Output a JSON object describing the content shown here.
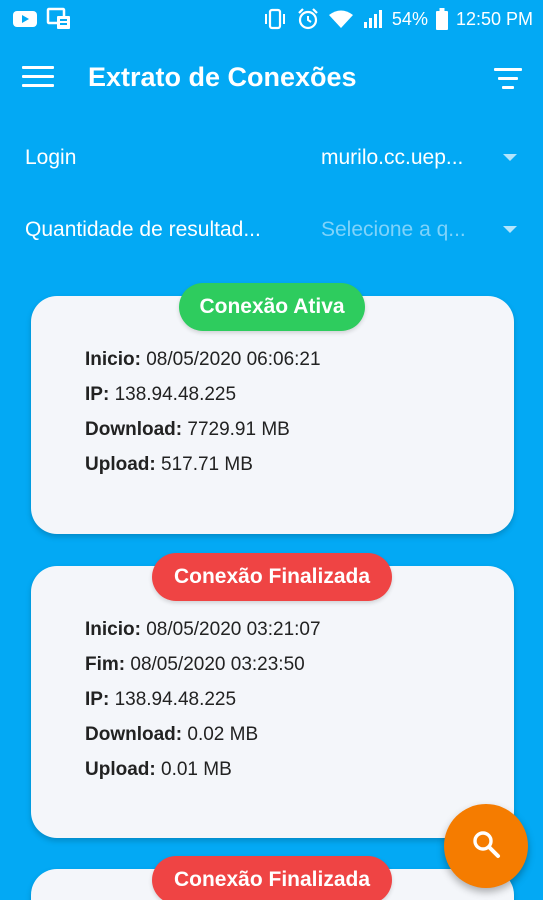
{
  "status_bar": {
    "battery": "54%",
    "time": "12:50 PM"
  },
  "app_bar": {
    "title": "Extrato de Conexões"
  },
  "filters": {
    "login_label": "Login",
    "login_value": "murilo.cc.uep...",
    "quantity_label": "Quantidade de resultad...",
    "quantity_placeholder": "Selecione a q..."
  },
  "labels": {
    "start": "Inicio:",
    "end": "Fim:",
    "ip": "IP:",
    "download": "Download:",
    "upload": "Upload:"
  },
  "connections": [
    {
      "status": "Conexão Ativa",
      "start": "08/05/2020 06:06:21",
      "ip": "138.94.48.225",
      "download": "7729.91 MB",
      "upload": "517.71 MB"
    },
    {
      "status": "Conexão Finalizada",
      "start": "08/05/2020 03:21:07",
      "end": "08/05/2020 03:23:50",
      "ip": "138.94.48.225",
      "download": "0.02 MB",
      "upload": "0.01 MB"
    },
    {
      "status": "Conexão Finalizada"
    }
  ],
  "colors": {
    "background": "#03A9F4",
    "card": "#F4F6FA",
    "active_badge": "#2ECC5E",
    "ended_badge": "#EF4444",
    "fab": "#F57C00"
  },
  "icons": {
    "fab": "search-icon",
    "menu": "menu-icon",
    "filter": "filter-icon"
  }
}
